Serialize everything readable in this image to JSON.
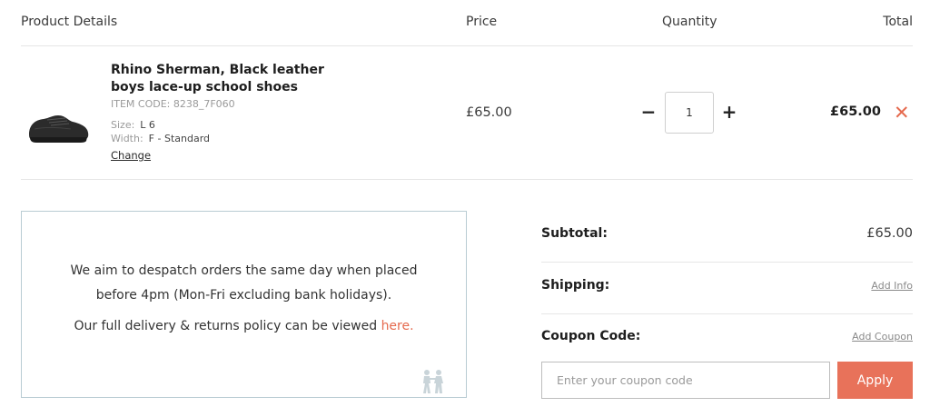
{
  "table_header": {
    "product_details": "Product Details",
    "price": "Price",
    "quantity": "Quantity",
    "total": "Total"
  },
  "item": {
    "name": "Rhino Sherman, Black leather boys lace-up school shoes",
    "item_code": "ITEM CODE: 8238_7F060",
    "size_label": "Size:",
    "size_value": "L 6",
    "width_label": "Width:",
    "width_value": "F - Standard",
    "change_label": "Change",
    "price": "£65.00",
    "quantity": "1",
    "total": "£65.00",
    "decrement_symbol": "−",
    "increment_symbol": "+",
    "remove_symbol": "✕",
    "image_icon": "black-lace-up-school-shoe"
  },
  "info": {
    "despatch_text": "We aim to despatch orders the same day when placed before 4pm (Mon-Fri excluding bank holidays).",
    "policy_text": "Our full delivery & returns policy can be viewed ",
    "policy_link": "here.",
    "decor_icon": "children-walking-icon"
  },
  "summary": {
    "subtotal_label": "Subtotal:",
    "subtotal_value": "£65.00",
    "shipping_label": "Shipping:",
    "shipping_link": "Add Info",
    "coupon_label": "Coupon Code:",
    "coupon_link": "Add Coupon",
    "coupon_placeholder": "Enter your coupon code",
    "apply_label": "Apply"
  },
  "colors": {
    "accent": "#e8725a",
    "remove": "#e56a4e",
    "info_border": "#b9ccd3"
  }
}
